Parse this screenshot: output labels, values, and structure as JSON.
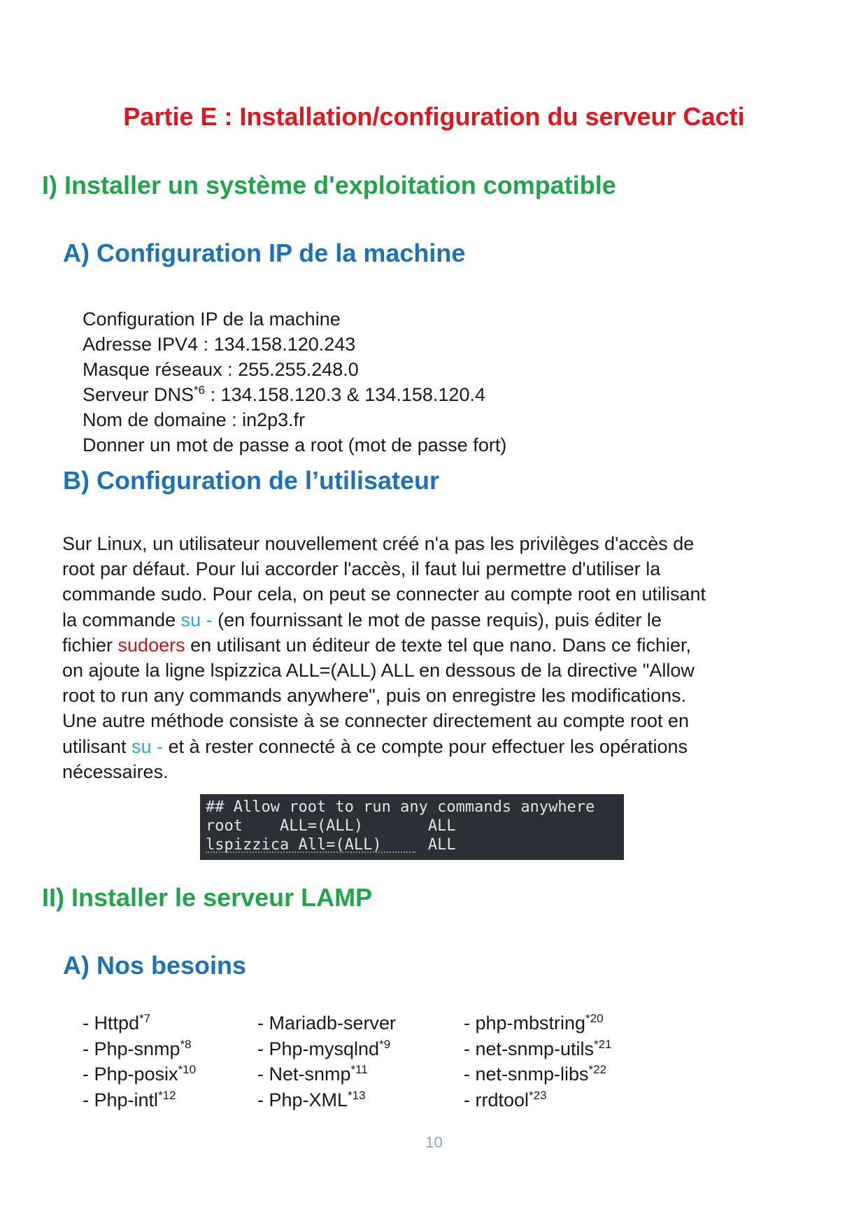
{
  "partie_title": "Partie E : Installation/configuration du serveur Cacti",
  "section1": {
    "title": "I) Installer un système d'exploitation compatible",
    "subA": {
      "title": "A) Configuration IP de la machine",
      "lines": [
        "Configuration IP de la machine",
        "Adresse IPV4 : 134.158.120.243",
        "Masque réseaux : 255.255.248.0",
        "Serveur DNS",
        "*6",
        " : 134.158.120.3 & 134.158.120.4",
        "Nom de domaine : in2p3.fr",
        "Donner un mot de passe a root (mot de passe fort)"
      ]
    },
    "subB": {
      "title": "B) Configuration de l’utilisateur",
      "paragraph": {
        "l1": "Sur Linux, un utilisateur nouvellement créé n'a pas les privilèges d'accès de",
        "l2": "root par défaut. Pour lui accorder l'accès, il faut lui permettre d'utiliser la",
        "l3": "commande sudo. Pour cela, on peut se connecter au compte root en utilisant",
        "l4a": "la commande ",
        "l4b": "su -",
        "l4c": " (en fournissant le mot de passe requis), puis éditer le",
        "l5a": "fichier ",
        "l5b": "sudoers",
        "l5c": " en utilisant un éditeur de texte tel que nano. Dans ce fichier,",
        "l6": "on ajoute la ligne lspizzica ALL=(ALL) ALL en dessous de la directive \"Allow",
        "l7": "root to run any commands anywhere\", puis on enregistre les modifications.",
        "l8": "Une autre méthode consiste à se connecter directement au compte root en",
        "l9a": "utilisant ",
        "l9b": "su -",
        "l9c": " et à rester connecté à ce compte pour effectuer les opérations",
        "l10": "nécessaires."
      },
      "terminal": {
        "line1": "## Allow root to run any commands anywhere",
        "line2": "root    ALL=(ALL)       ALL",
        "line3": "lspizzica All=(ALL)     ALL"
      }
    }
  },
  "section2": {
    "title": "II) Installer le serveur LAMP",
    "subA": {
      "title": "A) Nos besoins",
      "columns": [
        [
          {
            "name": "- Httpd",
            "note": "*7"
          },
          {
            "name": "- Php-snmp",
            "note": "*8"
          },
          {
            "name": "- Php-posix",
            "note": "*10"
          },
          {
            "name": "- Php-intl",
            "note": "*12"
          }
        ],
        [
          {
            "name": "- Mariadb-server",
            "note": ""
          },
          {
            "name": "- Php-mysqlnd",
            "note": "*9"
          },
          {
            "name": "- Net-snmp",
            "note": "*11"
          },
          {
            "name": "- Php-XML",
            "note": "*13"
          }
        ],
        [
          {
            "name": "- php-mbstring",
            "note": "*20"
          },
          {
            "name": "- net-snmp-utils",
            "note": "*21"
          },
          {
            "name": "- net-snmp-libs",
            "note": "*22"
          },
          {
            "name": "- rrdtool",
            "note": "*23"
          }
        ]
      ]
    }
  },
  "page_number": "10",
  "colors": {
    "partie": "#e8141b",
    "section": "#1fa64a",
    "subsection": "#1b72b8",
    "command": "#2aa7d8",
    "file": "#c0161b",
    "page_number": "#7fa7cf",
    "terminal_bg": "#2b3036"
  }
}
